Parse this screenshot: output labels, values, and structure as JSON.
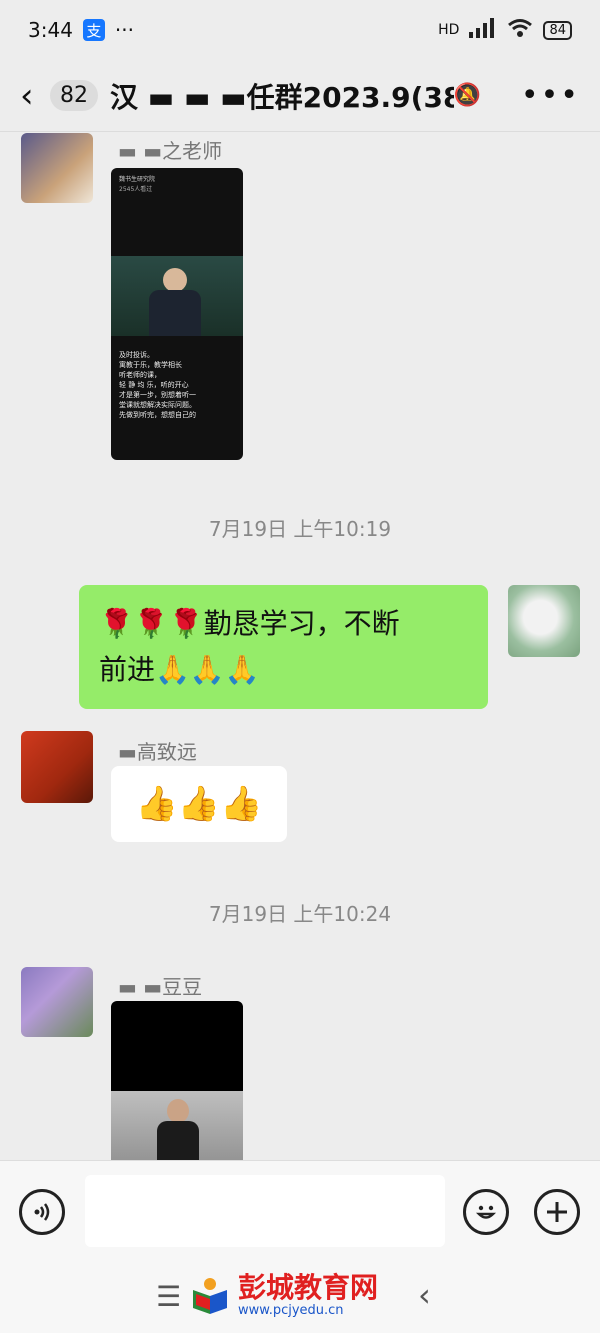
{
  "status_bar": {
    "time": "3:44",
    "alipay_glyph": "支",
    "overflow": "···",
    "network": "HD",
    "battery": "84"
  },
  "header": {
    "unread_count": "82",
    "title": "汉 ▬ ▬ ▬任群2023.9(38)"
  },
  "messages": [
    {
      "type": "image",
      "sender_name": "▬ ▬之老师",
      "caption_lines": [
        "魏书生研究院",
        "2545人看过",
        "及时投诉。",
        "寓教于乐，教学相长",
        "听老师的课，",
        "轻 静 均 乐，听的开心",
        "才是第一步，别想着听一",
        "堂课就想解决实际问题。",
        "先做到听完，想想自己的"
      ]
    },
    {
      "type": "time",
      "text": "7月19日 上午10:19"
    },
    {
      "type": "text_me",
      "text_line1": "🌹🌹🌹勤恳学习，不断",
      "text_line2": "前进🙏🙏🙏"
    },
    {
      "type": "emoji",
      "sender_name": "▬高致远",
      "emoji": "👍👍👍"
    },
    {
      "type": "time",
      "text": "7月19日 上午10:24"
    },
    {
      "type": "image",
      "sender_name": "▬ ▬豆豆"
    }
  ],
  "watermark": {
    "title": "彭城教育网",
    "url": "www.pcjyedu.cn"
  },
  "colors": {
    "my_bubble": "#95ec69",
    "background": "#ededed"
  }
}
